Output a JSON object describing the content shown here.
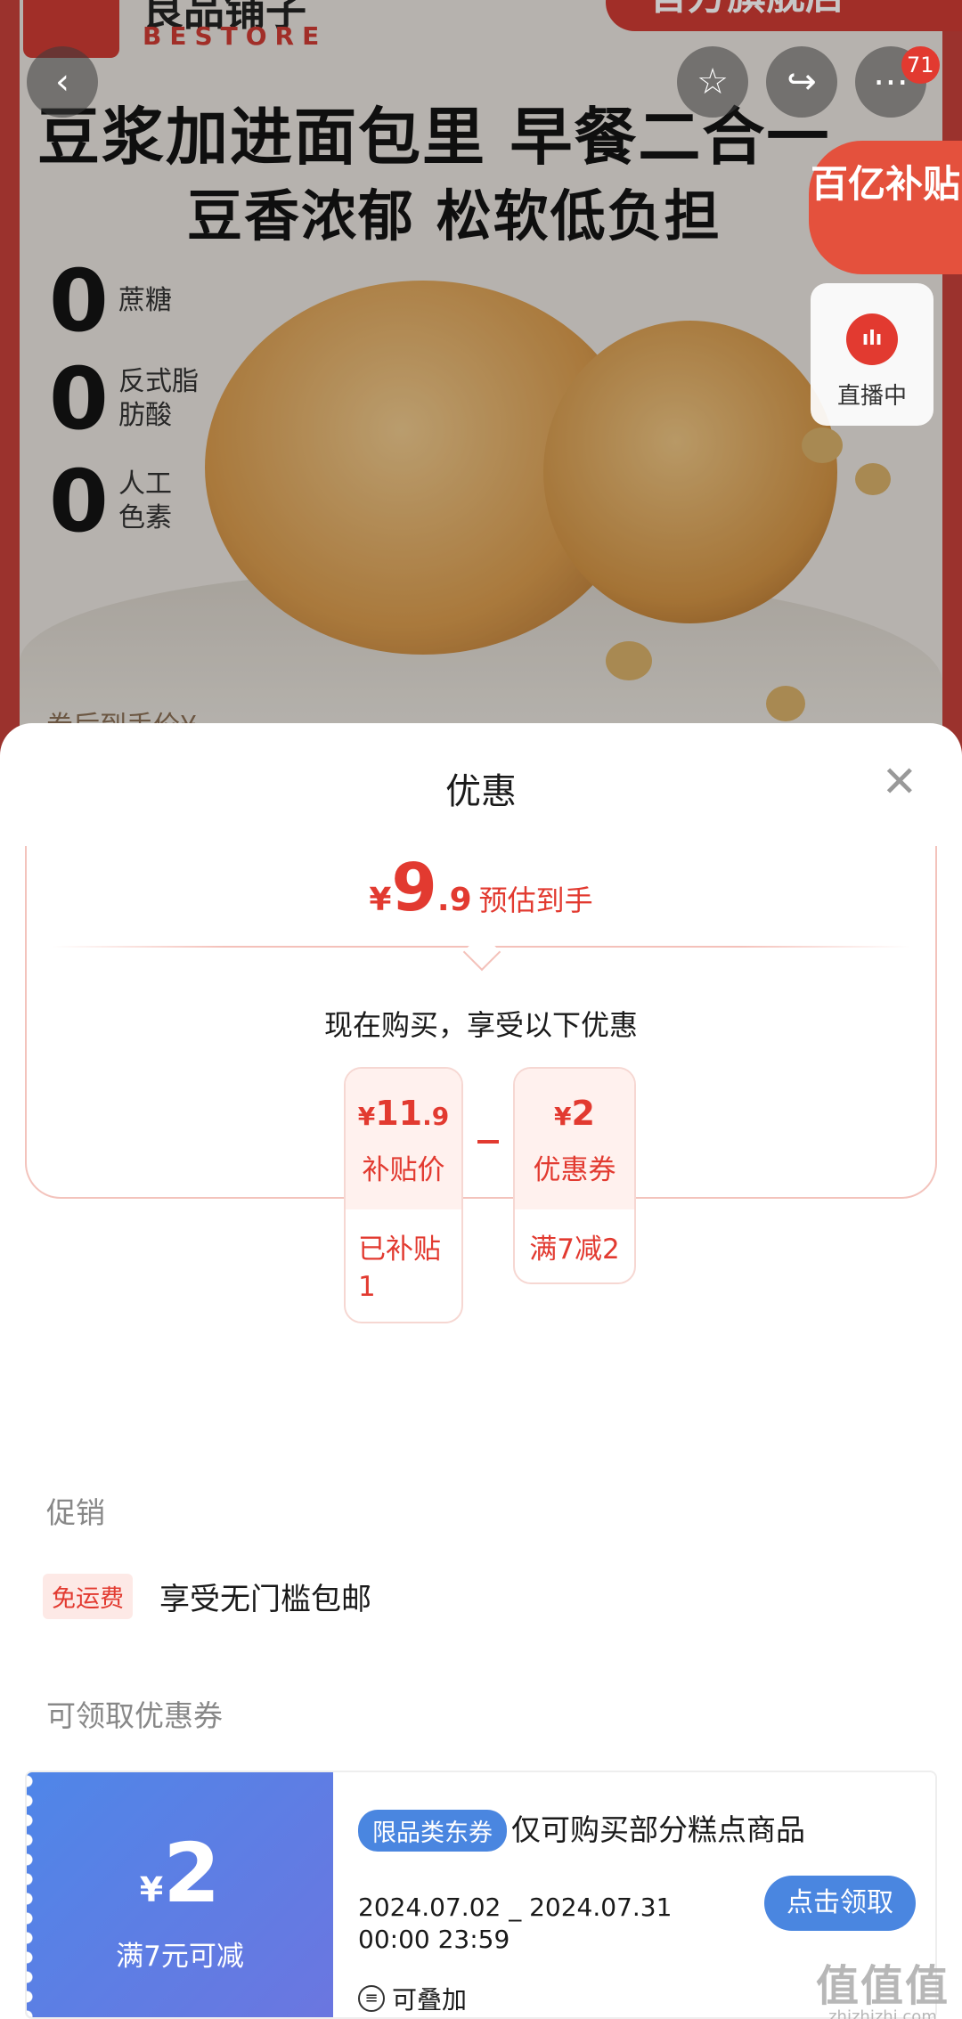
{
  "product_banner": {
    "brand_cn": "良品铺子",
    "brand_en": "BESTORE",
    "store_tag": "官方旗舰店",
    "headline": "豆浆加进面包里 早餐二合一",
    "subheadline": "豆香浓郁 松软低负担",
    "claims": [
      {
        "zero": "0",
        "text": "蔗糖"
      },
      {
        "zero": "0",
        "text": "反式脂肪酸"
      },
      {
        "zero": "0",
        "text": "人工色素"
      }
    ],
    "bottom_hint": "券后到手价¥"
  },
  "top_bar": {
    "back_icon": "‹",
    "favorite_icon": "☆",
    "share_icon": "↪",
    "more_icon": "⋯",
    "message_badge": "71"
  },
  "subsidy_tag": "百亿补贴",
  "live": {
    "icon_text": "ılı",
    "label": "直播中"
  },
  "sheet": {
    "title": "优惠",
    "close_icon": "✕",
    "estimate": {
      "currency": "¥",
      "integer": "9",
      "decimal": ".9",
      "label": "预估到手"
    },
    "buy_now": "现在购买，享受以下优惠",
    "deals": [
      {
        "currency": "¥",
        "integer": "11",
        "decimal": ".9",
        "kind": "补贴价",
        "note": "已补贴1"
      },
      {
        "currency": "¥",
        "integer": "2",
        "decimal": "",
        "kind": "优惠券",
        "note": "满7减2"
      }
    ],
    "promotion_label": "促销",
    "promotion": {
      "tag": "免运费",
      "text": "享受无门槛包邮"
    },
    "coupons_label": "可领取优惠券",
    "coupon": {
      "currency": "¥",
      "amount": "2",
      "condition": "满7元可减",
      "tag": "限品类东券",
      "title": "仅可购买部分糕点商品",
      "date_line1": "2024.07.02 _ 2024.07.31",
      "date_line2": "00:00 23:59",
      "stackable": "可叠加",
      "button": "点击领取"
    }
  },
  "watermark": {
    "glyphs": "值值值",
    "url": "zhizhizhi.com"
  },
  "colors": {
    "accent": "#e23a30",
    "coupon_blue": "#4a86e0",
    "brand_red": "#cf3b34"
  }
}
